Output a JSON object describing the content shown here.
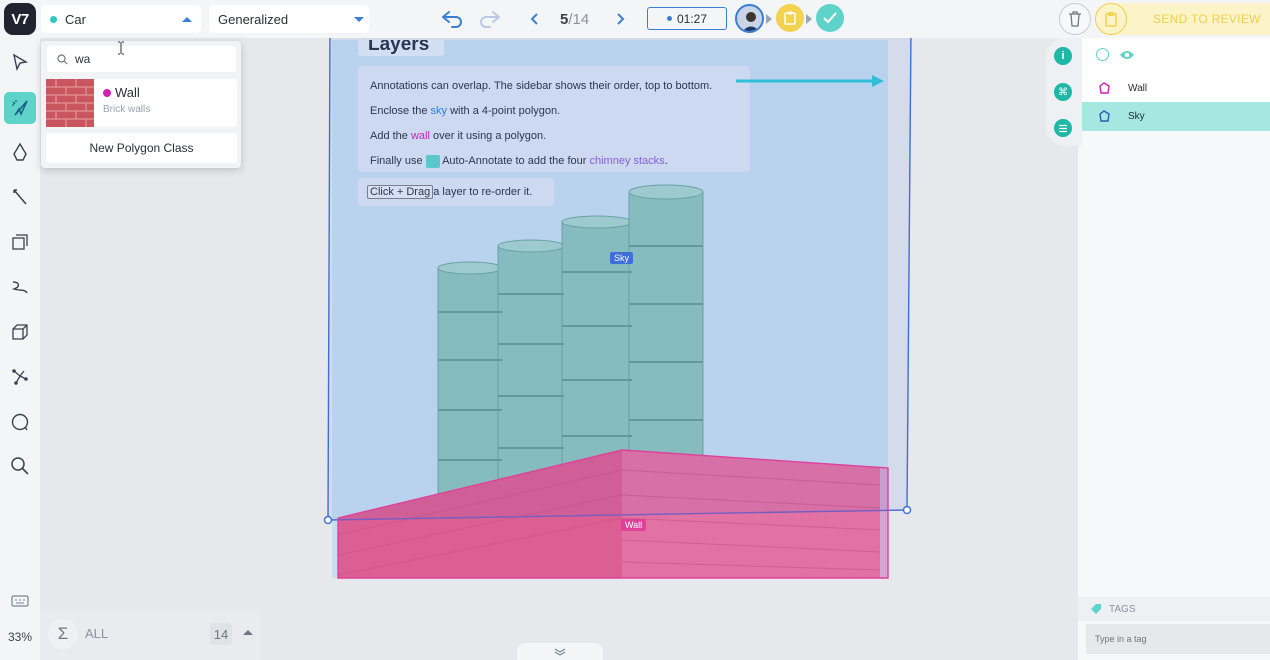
{
  "app": {
    "logo": "V7"
  },
  "topbar": {
    "class_select": {
      "label": "Car",
      "color": "#35c6bd"
    },
    "mode_select": {
      "label": "Generalized"
    },
    "pager": {
      "current": "5",
      "total": "/14"
    },
    "timer": "01:27",
    "send_to_review": "SEND TO REVIEW"
  },
  "dropdown": {
    "search_value": "wa",
    "result": {
      "name": "Wall",
      "description": "Brick walls",
      "color": "#d21fb0"
    },
    "new_class_button": "New Polygon Class"
  },
  "canvas": {
    "tutorial": {
      "title": "Layers",
      "line1": "Annotations can overlap. The sidebar shows their order, top to bottom.",
      "line2_pre": "Enclose the ",
      "line2_hl": "sky",
      "line2_post": " with a 4-point polygon.",
      "line3_pre": "Add the ",
      "line3_hl": "wall",
      "line3_post": " over it using a polygon.",
      "line4_pre": "Finally use ",
      "line4_mid": " Auto-Annotate to add the four ",
      "line4_hl": "chimney stacks",
      "line4_post": ".",
      "hint_key": "Click + Drag",
      "hint_text": " a layer to re-order it."
    },
    "labels": {
      "sky": "Sky",
      "wall": "Wall"
    }
  },
  "layers": [
    {
      "name": "Wall",
      "color": "#d21fb0",
      "selected": false
    },
    {
      "name": "Sky",
      "color": "#2a5db0",
      "selected": true
    }
  ],
  "tags": {
    "label": "TAGS",
    "placeholder": "Type in a tag"
  },
  "bottom": {
    "zoom": "33%",
    "filter_label": "ALL",
    "count": "14"
  },
  "colors": {
    "accent": "#5fd2c9",
    "sky_annotation": "#3d6fd8",
    "wall_annotation": "#e0409a",
    "review": "#f3d24f"
  }
}
